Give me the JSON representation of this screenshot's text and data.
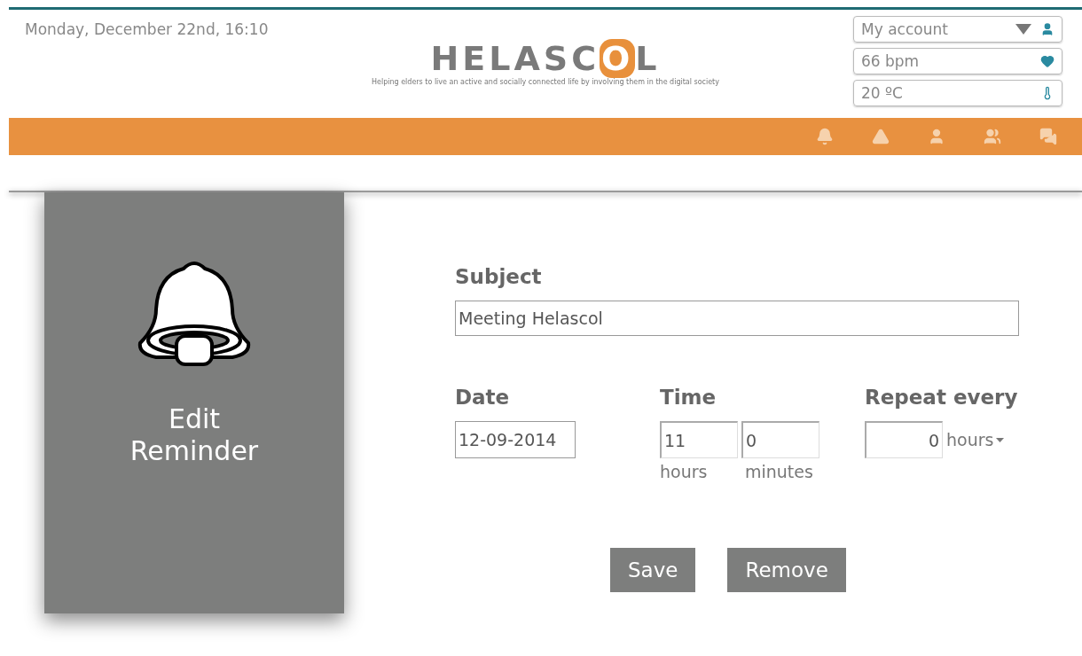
{
  "header": {
    "datetime": "Monday, December 22nd, 16:10",
    "logo": {
      "before": "HELASC",
      "highlight": "O",
      "after": "L",
      "tagline": "Helping elders to live an active and socially connected life by involving them in the digital society"
    },
    "status": [
      {
        "kind": "account",
        "label": "My account"
      },
      {
        "kind": "heart",
        "label": "66 bpm"
      },
      {
        "kind": "temperature",
        "label": "20 ºC"
      }
    ]
  },
  "nav": [
    {
      "kind": "bell"
    },
    {
      "kind": "warning"
    },
    {
      "kind": "user"
    },
    {
      "kind": "users"
    },
    {
      "kind": "chat"
    }
  ],
  "panel": {
    "title": "Edit Reminder"
  },
  "form": {
    "subject": {
      "label": "Subject",
      "value": "Meeting Helascol"
    },
    "date": {
      "label": "Date",
      "value": "12-09-2014"
    },
    "time": {
      "label": "Time",
      "hours": "11",
      "hours_label": "hours",
      "minutes": "0",
      "minutes_label": "minutes"
    },
    "repeat": {
      "label": "Repeat every",
      "value": "0",
      "unit": "hours"
    },
    "buttons": [
      "Save",
      "Remove"
    ]
  }
}
